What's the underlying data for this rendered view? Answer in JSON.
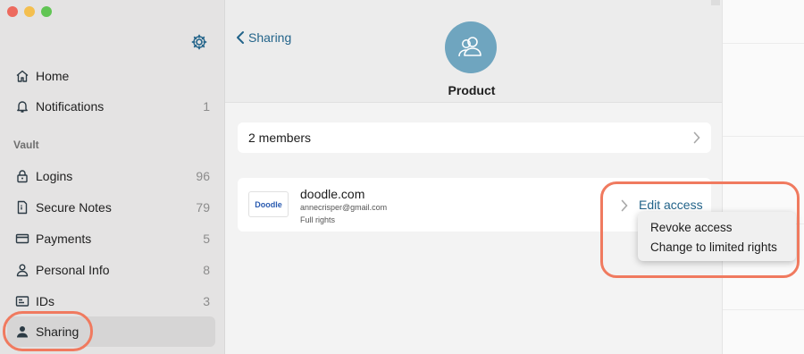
{
  "sidebar": {
    "nav": [
      {
        "label": "Home",
        "count": "",
        "icon": "home-icon"
      },
      {
        "label": "Notifications",
        "count": "1",
        "icon": "bell-icon"
      }
    ],
    "vault_label": "Vault",
    "vault": [
      {
        "label": "Logins",
        "count": "96",
        "icon": "lock-icon"
      },
      {
        "label": "Secure Notes",
        "count": "79",
        "icon": "note-icon"
      },
      {
        "label": "Payments",
        "count": "5",
        "icon": "card-icon"
      },
      {
        "label": "Personal Info",
        "count": "8",
        "icon": "person-icon"
      },
      {
        "label": "IDs",
        "count": "3",
        "icon": "id-icon"
      },
      {
        "label": "Sharing",
        "count": "",
        "icon": "sharing-icon"
      }
    ]
  },
  "main": {
    "back_label": "Sharing",
    "group_title": "Product",
    "members_label": "2 members",
    "member": {
      "logo_text": "Doodle",
      "title": "doodle.com",
      "email": "annecrisper@gmail.com",
      "rights": "Full rights",
      "edit_label": "Edit access"
    }
  },
  "menu": {
    "items": [
      "Revoke access",
      "Change to limited rights"
    ]
  },
  "colors": {
    "accent": "#23648a",
    "highlight_ring": "#f07a5f",
    "group_avatar": "#6fa5bf"
  }
}
